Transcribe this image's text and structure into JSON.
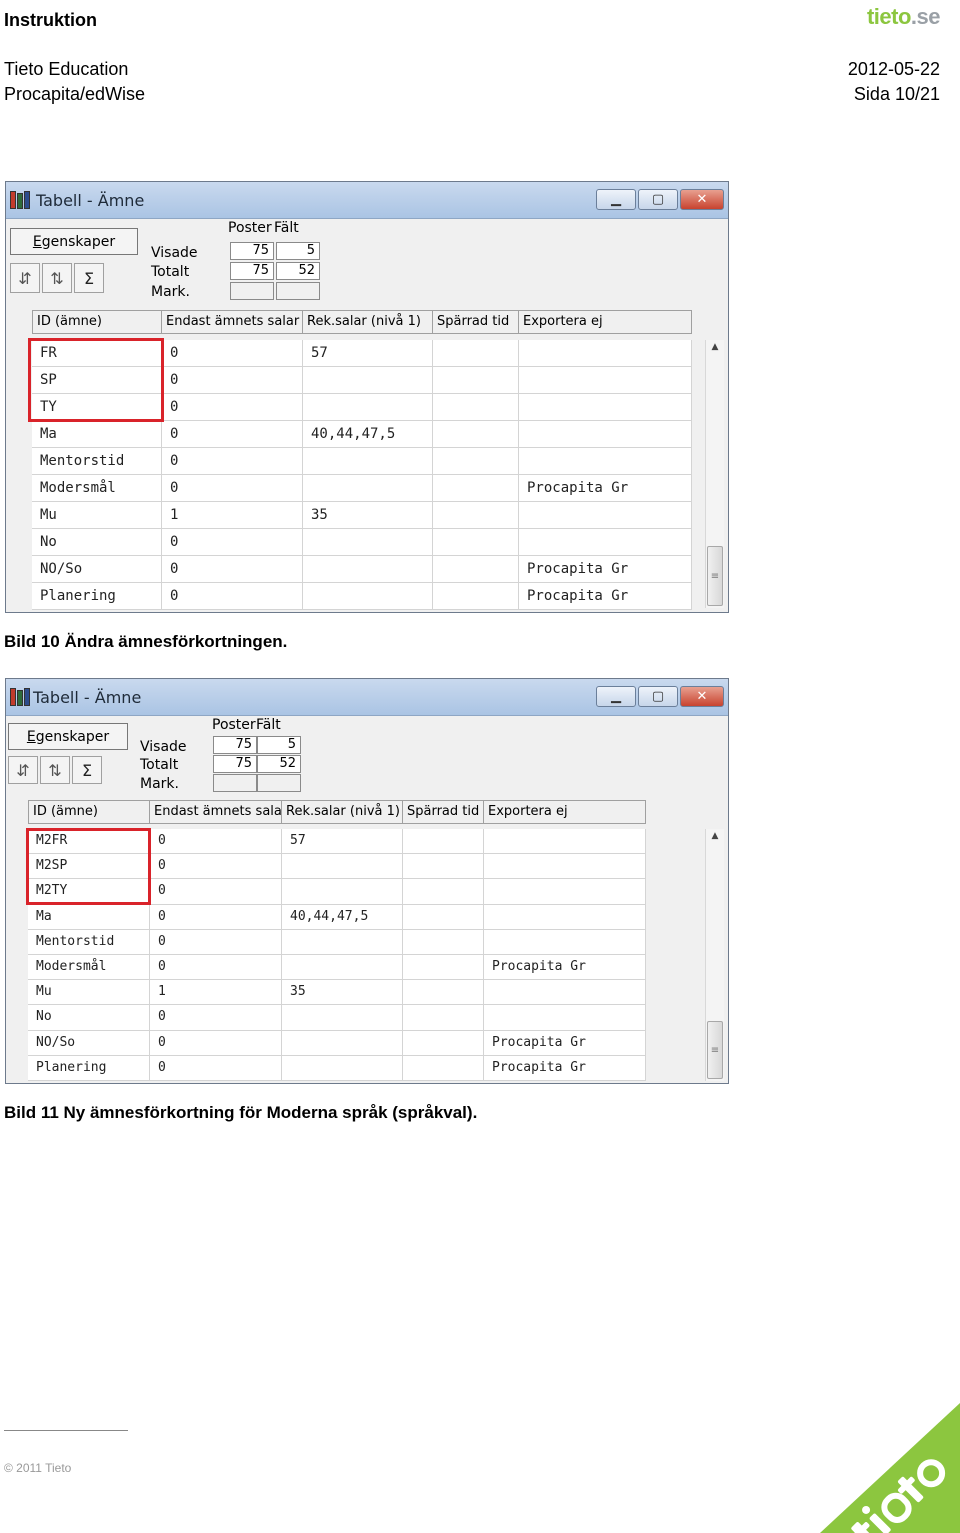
{
  "header": {
    "doc_type": "Instruktion",
    "brand_word": "tieto",
    "brand_suffix": "se",
    "organisation": "Tieto Education",
    "product": "Procapita/edWise",
    "date": "2012-05-22",
    "page": "Sida 10/21"
  },
  "colors": {
    "brand_green": "#8cc63f",
    "highlight_red": "#d9232a"
  },
  "windows": [
    {
      "title": "Tabell - Ämne",
      "properties_button": {
        "underlined": "E",
        "rest": "genskaper"
      },
      "counts": {
        "poster_label": "Poster",
        "falt_label": "Fält",
        "visade_label": "Visade",
        "totalt_label": "Totalt",
        "mark_label": "Mark.",
        "visade_poster": "75",
        "visade_falt": "5",
        "totalt_poster": "75",
        "totalt_falt": "52"
      },
      "columns": [
        "ID (ämne)",
        "Endast ämnets salar",
        "Rek.salar (nivå 1)",
        "Spärrad tid",
        "Exportera ej"
      ],
      "rows": [
        [
          "FR",
          "0",
          "57",
          "",
          ""
        ],
        [
          "SP",
          "0",
          "",
          "",
          ""
        ],
        [
          "TY",
          "0",
          "",
          "",
          ""
        ],
        [
          "Ma",
          "0",
          "40,44,47,5",
          "",
          ""
        ],
        [
          "Mentorstid",
          "0",
          "",
          "",
          ""
        ],
        [
          "Modersmål",
          "0",
          "",
          "",
          "Procapita Gr"
        ],
        [
          "Mu",
          "1",
          "35",
          "",
          ""
        ],
        [
          "No",
          "0",
          "",
          "",
          ""
        ],
        [
          "NO/So",
          "0",
          "",
          "",
          "Procapita Gr"
        ],
        [
          "Planering",
          "0",
          "",
          "",
          "Procapita Gr"
        ]
      ]
    },
    {
      "title": "Tabell - Ämne",
      "properties_button": {
        "underlined": "E",
        "rest": "genskaper"
      },
      "counts": {
        "poster_label": "Poster",
        "falt_label": "Fält",
        "visade_label": "Visade",
        "totalt_label": "Totalt",
        "mark_label": "Mark.",
        "visade_poster": "75",
        "visade_falt": "5",
        "totalt_poster": "75",
        "totalt_falt": "52"
      },
      "columns": [
        "ID (ämne)",
        "Endast ämnets salar",
        "Rek.salar (nivå 1)",
        "Spärrad tid",
        "Exportera ej"
      ],
      "rows": [
        [
          "M2FR",
          "0",
          "57",
          "",
          ""
        ],
        [
          "M2SP",
          "0",
          "",
          "",
          ""
        ],
        [
          "M2TY",
          "0",
          "",
          "",
          ""
        ],
        [
          "Ma",
          "0",
          "40,44,47,5",
          "",
          ""
        ],
        [
          "Mentorstid",
          "0",
          "",
          "",
          ""
        ],
        [
          "Modersmål",
          "0",
          "",
          "",
          "Procapita Gr"
        ],
        [
          "Mu",
          "1",
          "35",
          "",
          ""
        ],
        [
          "No",
          "0",
          "",
          "",
          ""
        ],
        [
          "NO/So",
          "0",
          "",
          "",
          "Procapita Gr"
        ],
        [
          "Planering",
          "0",
          "",
          "",
          "Procapita Gr"
        ]
      ]
    }
  ],
  "captions": [
    "Bild 10 Ändra ämnesförkortningen.",
    "Bild 11 Ny ämnesförkortning för Moderna språk (språkval)."
  ],
  "footer": {
    "copyright": "© 2011 Tieto"
  },
  "icons": {
    "minimize": "minimize-icon",
    "maximize": "maximize-icon",
    "close": "close-icon",
    "sort_desc": "sort-icon",
    "sort_az": "sort-az-icon",
    "sum": "sum-icon"
  }
}
